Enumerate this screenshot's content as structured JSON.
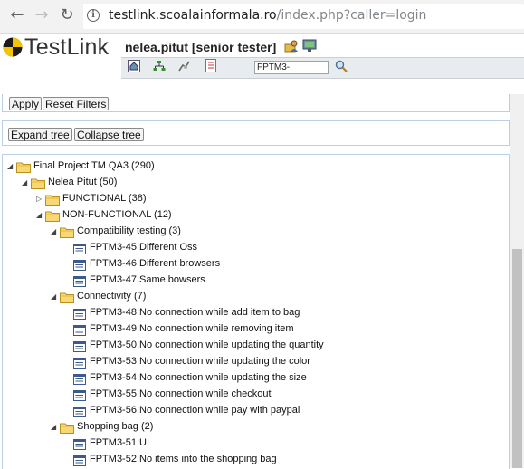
{
  "browser": {
    "back_icon": "arrow-left-icon",
    "forward_icon": "arrow-right-icon",
    "reload_icon": "reload-icon",
    "info_icon": "info-icon",
    "url_host": "testlink.scoalainformala.ro",
    "url_path": "/index.php?caller=login"
  },
  "header": {
    "logo_text": "TestLink",
    "user": "nelea.pitut [senior tester]",
    "testcase_search_value": "FPTM3-",
    "icons": [
      "home-icon",
      "sitemap-icon",
      "bug-icon",
      "notes-icon",
      "folder-user-icon",
      "monitor-icon",
      "search-icon"
    ]
  },
  "filters": {
    "apply_label": "Apply",
    "reset_label": "Reset Filters"
  },
  "tree_controls": {
    "expand_label": "Expand tree",
    "collapse_label": "Collapse tree"
  },
  "tree": {
    "nodes": [
      {
        "type": "folder",
        "state": "open",
        "label": "Final Project TM QA3 (290)"
      },
      {
        "type": "folder",
        "state": "open",
        "label": "Nelea Pitut (50)"
      },
      {
        "type": "folder",
        "state": "closed",
        "label": "FUNCTIONAL (38)"
      },
      {
        "type": "folder",
        "state": "open",
        "label": "NON-FUNCTIONAL (12)"
      },
      {
        "type": "folder",
        "state": "open",
        "label": "Compatibility testing (3)"
      },
      {
        "type": "testcase",
        "label": "FPTM3-45:Different Oss"
      },
      {
        "type": "testcase",
        "label": "FPTM3-46:Different browsers"
      },
      {
        "type": "testcase",
        "label": "FPTM3-47:Same bowsers"
      },
      {
        "type": "folder",
        "state": "open",
        "label": "Connectivity (7)"
      },
      {
        "type": "testcase",
        "label": "FPTM3-48:No connection while add item to bag"
      },
      {
        "type": "testcase",
        "label": "FPTM3-49:No connection while removing item"
      },
      {
        "type": "testcase",
        "label": "FPTM3-50:No connection while updating the quantity"
      },
      {
        "type": "testcase",
        "label": "FPTM3-53:No connection while updating the color"
      },
      {
        "type": "testcase",
        "label": "FPTM3-54:No connection while updating the size"
      },
      {
        "type": "testcase",
        "label": "FPTM3-55:No connection while checkout"
      },
      {
        "type": "testcase",
        "label": "FPTM3-56:No connection while pay with paypal"
      },
      {
        "type": "folder",
        "state": "open",
        "label": "Shopping bag (2)"
      },
      {
        "type": "testcase",
        "label": "FPTM3-51:UI"
      },
      {
        "type": "testcase",
        "label": "FPTM3-52:No items into the shopping bag"
      }
    ]
  }
}
